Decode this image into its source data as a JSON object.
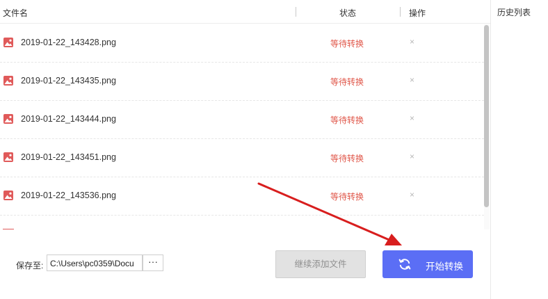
{
  "header": {
    "col_name": "文件名",
    "col_status": "状态",
    "col_op": "操作"
  },
  "sidebar": {
    "title": "历史列表"
  },
  "files": [
    {
      "name": "2019-01-22_143428.png",
      "status": "等待转换",
      "remove": "×"
    },
    {
      "name": "2019-01-22_143435.png",
      "status": "等待转换",
      "remove": "×"
    },
    {
      "name": "2019-01-22_143444.png",
      "status": "等待转换",
      "remove": "×"
    },
    {
      "name": "2019-01-22_143451.png",
      "status": "等待转换",
      "remove": "×"
    },
    {
      "name": "2019-01-22_143536.png",
      "status": "等待转换",
      "remove": "×"
    }
  ],
  "footer": {
    "save_label": "保存至:",
    "path": "C:\\Users\\pc0359\\Docu",
    "more": "···",
    "add_label": "继续添加文件",
    "start_label": "开始转换"
  },
  "colors": {
    "accent": "#5b6ef5",
    "status": "#e0574a",
    "file_icon": "#e05a5a",
    "arrow": "#d81e1e"
  },
  "icons": {
    "file": "image-file-icon",
    "start": "refresh-icon",
    "remove": "close-icon"
  }
}
